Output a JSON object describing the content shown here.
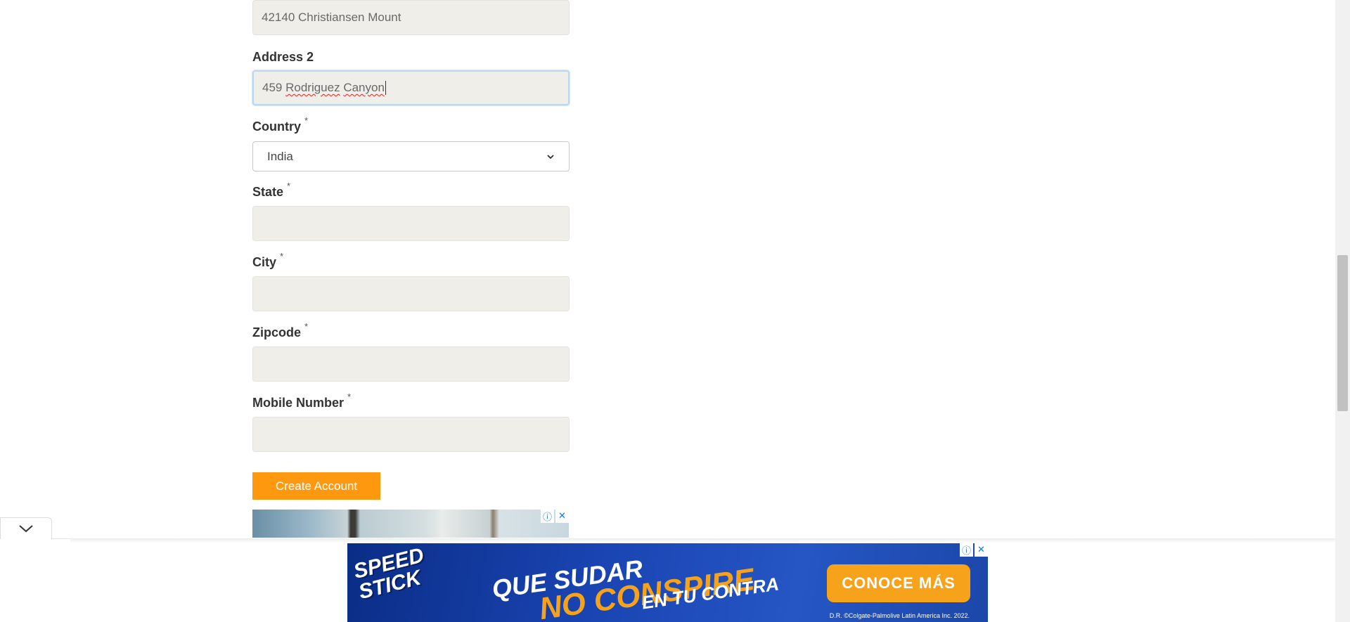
{
  "form": {
    "address1": {
      "value": "42140 Christiansen Mount"
    },
    "address2": {
      "label": "Address 2",
      "value_plain": "459 ",
      "value_word1": "Rodriguez",
      "value_space": " ",
      "value_word2": "Canyon"
    },
    "country": {
      "label": "Country",
      "required_mark": "*",
      "selected": "India"
    },
    "state": {
      "label": "State",
      "required_mark": "*",
      "value": ""
    },
    "city": {
      "label": "City",
      "required_mark": "*",
      "value": ""
    },
    "zipcode": {
      "label": "Zipcode",
      "required_mark": "*",
      "value": ""
    },
    "mobile": {
      "label": "Mobile Number",
      "required_mark": "*",
      "value": ""
    },
    "submit_label": "Create Account"
  },
  "ads": {
    "inline": {
      "info_glyph": "ⓘ",
      "close_glyph": "✕"
    },
    "anchor": {
      "logo_line1": "SPEED",
      "logo_line2": "STICK",
      "headline1": "QUE SUDAR",
      "headline2": "NO CONSPIRE",
      "headline3": "EN TU CONTRA",
      "cta": "CONOCE MÁS",
      "legal": "D.R. ©Colgate-Palmolive Latin America Inc. 2022.",
      "info_glyph": "ⓘ",
      "close_glyph": "✕"
    }
  },
  "colors": {
    "button": "#fe980f",
    "input_bg": "#efeee9",
    "ad_blue": "#1a45b3",
    "ad_orange": "#f7a21b"
  },
  "icons": {
    "select_arrow": "chevron-down-icon",
    "collapse_tab": "chevron-down-icon"
  }
}
